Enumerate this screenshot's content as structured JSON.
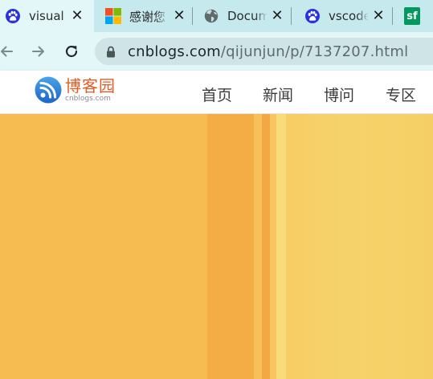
{
  "browser": {
    "tabs": [
      {
        "title": "visual",
        "favicon": "baidu-paw-icon",
        "active": true
      },
      {
        "title": "感谢您",
        "favicon": "microsoft-logo-icon",
        "active": false
      },
      {
        "title": "Docum",
        "favicon": "globe-icon",
        "active": false
      },
      {
        "title": "vscode",
        "favicon": "baidu-paw-icon",
        "active": false
      },
      {
        "title": "sf",
        "favicon": "segmentfault-icon",
        "active": false
      }
    ],
    "toolbar": {
      "back_icon": "arrow-left-icon",
      "forward_icon": "arrow-right-icon",
      "reload_icon": "reload-icon",
      "lock_icon": "lock-icon",
      "url_domain": "cnblogs.com",
      "url_path": "/qijunjun/p/7137207.html"
    }
  },
  "site": {
    "logo_text": "博客园",
    "logo_subtext": "cnblogs.com",
    "nav": [
      "首页",
      "新闻",
      "博问",
      "专区"
    ]
  },
  "colors": {
    "tabstrip_bg": "#c6e9ee",
    "toolbar_bg": "#e3f6f8",
    "page_bg": "#f6bc52",
    "brand": "#e35b24"
  }
}
